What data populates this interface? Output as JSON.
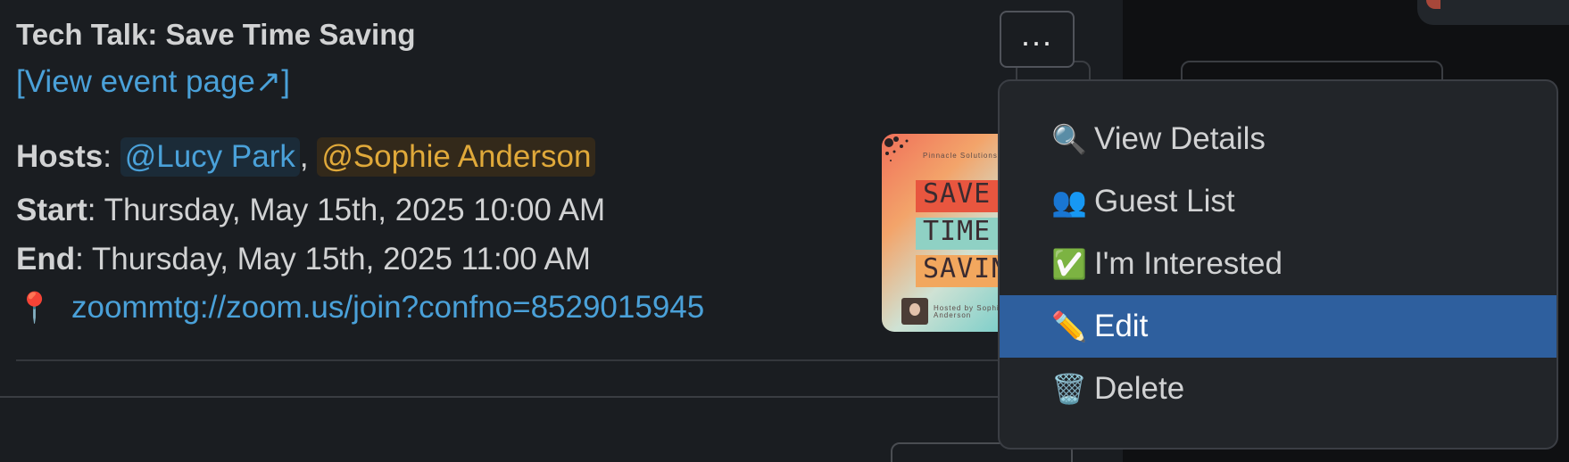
{
  "event": {
    "title": "Tech Talk: Save Time Saving",
    "view_link": "[View event page↗]",
    "hosts_label": "Hosts",
    "hosts": [
      "@Lucy Park",
      "@Sophie Anderson"
    ],
    "start_label": "Start",
    "start_value": ": Thursday, May 15th, 2025 10:00 AM",
    "end_label": "End",
    "end_value": ": Thursday, May 15th, 2025 11:00 AM",
    "location_icon": "round-pushpin-icon",
    "location_emoji": "📍",
    "location_link": "zoommtg://zoom.us/join?confno=8529015945"
  },
  "poster": {
    "company": "Pinnacle Solutions",
    "line1": "SAVE",
    "line2": "TIME",
    "line3": "SAVING",
    "hosted_by": "Hosted by Sophie Anderson",
    "colors": {
      "band1": "#e8563f",
      "band2": "#8fd1c4",
      "band3": "#f2a75e"
    }
  },
  "more_button": {
    "label": "...",
    "icon": "ellipsis-icon"
  },
  "menu": {
    "items": [
      {
        "emoji": "🔍",
        "icon": "magnifier-icon",
        "label": "View Details"
      },
      {
        "emoji": "👥",
        "icon": "people-icon",
        "label": "Guest List"
      },
      {
        "emoji": "✅",
        "icon": "check-mark-icon",
        "label": "I'm Interested"
      },
      {
        "emoji": "✏️",
        "icon": "pencil-icon",
        "label": "Edit"
      },
      {
        "emoji": "🗑️",
        "icon": "trash-icon",
        "label": "Delete"
      }
    ],
    "highlighted_index": 3
  },
  "colors": {
    "background": "#1a1d21",
    "link": "#4aa1d9",
    "mention_gold": "#e0a93a",
    "menu_highlight": "#2e5f9e"
  }
}
